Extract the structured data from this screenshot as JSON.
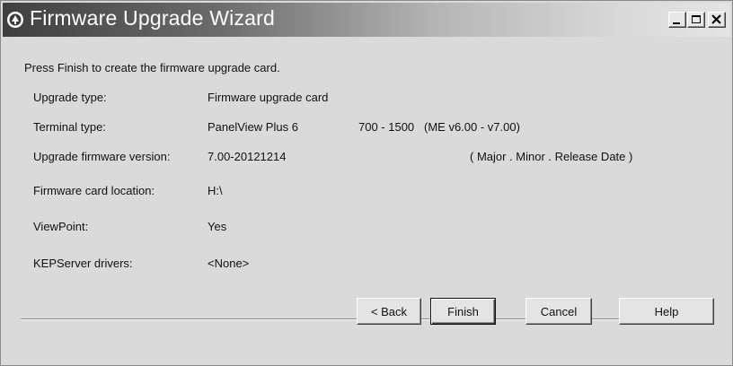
{
  "window": {
    "title": "Firmware Upgrade Wizard",
    "controls": [
      "minimize",
      "maximize",
      "close"
    ]
  },
  "instruction": "Press Finish to create the firmware upgrade card.",
  "fields": {
    "upgrade_type": {
      "label": "Upgrade type:",
      "value": "Firmware upgrade card"
    },
    "terminal_type": {
      "label": "Terminal type:",
      "value": "PanelView Plus 6",
      "extra": "700 - 1500   (ME v6.00 - v7.00)"
    },
    "firmware_version": {
      "label": "Upgrade firmware version:",
      "value": "7.00-20121214",
      "hint": "( Major . Minor . Release Date )"
    },
    "card_location": {
      "label": "Firmware card location:",
      "value": "H:\\"
    },
    "viewpoint": {
      "label": "ViewPoint:",
      "value": "Yes"
    },
    "kepserver": {
      "label": "KEPServer drivers:",
      "value": "<None>"
    }
  },
  "buttons": {
    "back": "< Back",
    "finish": "Finish",
    "cancel": "Cancel",
    "help": "Help"
  },
  "colors": {
    "dialog_bg": "#dadada",
    "titlebar_dark": "#3f3f3f",
    "titlebar_light": "#e4e4e4"
  }
}
